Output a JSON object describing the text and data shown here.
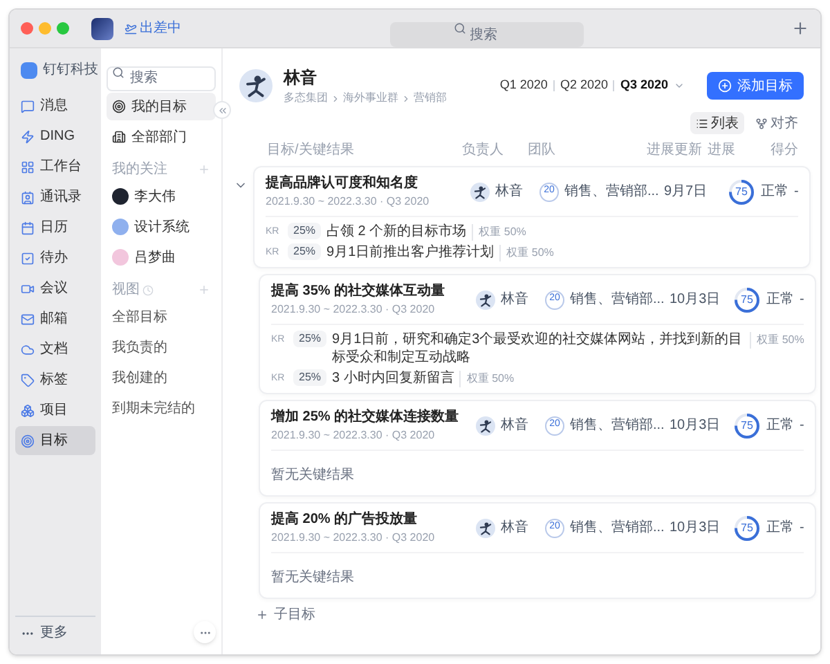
{
  "titlebar": {
    "status": "出差中",
    "search_placeholder": "搜索"
  },
  "org": {
    "name": "钉钉科技"
  },
  "nav": [
    {
      "label": "消息",
      "selected": false
    },
    {
      "label": "DING",
      "selected": false
    },
    {
      "label": "工作台",
      "selected": false
    },
    {
      "label": "通讯录",
      "selected": false
    },
    {
      "label": "日历",
      "selected": false
    },
    {
      "label": "待办",
      "selected": false
    },
    {
      "label": "会议",
      "selected": false
    },
    {
      "label": "邮箱",
      "selected": false
    },
    {
      "label": "文档",
      "selected": false
    },
    {
      "label": "标签",
      "selected": false
    },
    {
      "label": "项目",
      "selected": false
    },
    {
      "label": "目标",
      "selected": true
    }
  ],
  "more": "更多",
  "panel": {
    "search_placeholder": "搜索",
    "items": [
      {
        "label": "我的目标",
        "selected": true
      },
      {
        "label": "全部部门",
        "selected": false
      }
    ],
    "following_title": "我的关注",
    "following": [
      {
        "name": "李大伟",
        "color": "#1f2430"
      },
      {
        "name": "设计系统",
        "color": "#8fb0ee"
      },
      {
        "name": "吕梦曲",
        "color": "#f2c6dd"
      }
    ],
    "views_title": "视图",
    "views": [
      {
        "label": "全部目标",
        "selected": false
      },
      {
        "label": "我负责的",
        "selected": false
      },
      {
        "label": "我创建的",
        "selected": false
      },
      {
        "label": "到期未完结的",
        "selected": false
      }
    ]
  },
  "header": {
    "name": "林音",
    "path": [
      "多态集团",
      "海外事业群",
      "营销部"
    ],
    "quarters": [
      {
        "label": "Q1 2020",
        "selected": false
      },
      {
        "label": "Q2 2020",
        "selected": false
      },
      {
        "label": "Q3 2020",
        "selected": true
      }
    ],
    "add_button": "添加目标",
    "views": [
      {
        "label": "列表",
        "selected": true
      },
      {
        "label": "对齐",
        "selected": false
      }
    ]
  },
  "columns": [
    "目标/关键结果",
    "负责人",
    "团队",
    "进展更新",
    "进展",
    "得分"
  ],
  "goals": [
    {
      "title": "提高品牌认可度和知名度",
      "dates": "2021.9.30 ~ 2022.3.30 · Q3 2020",
      "owner": "林音",
      "team_count": "20",
      "team": "销售、营销部...",
      "updated": "9月7日",
      "progress": "75",
      "status": "正常",
      "score": "-",
      "expanded": true,
      "krs": [
        {
          "label": "KR",
          "percent": "25%",
          "text": "占领 2 个新的目标市场",
          "weight": "权重 50%"
        },
        {
          "label": "KR",
          "percent": "25%",
          "text": "9月1日前推出客户推荐计划",
          "weight": "权重 50%"
        }
      ],
      "children": [
        {
          "title": "提高 35% 的社交媒体互动量",
          "dates": "2021.9.30 ~ 2022.3.30 · Q3 2020",
          "owner": "林音",
          "team_count": "20",
          "team": "销售、营销部...",
          "updated": "10月3日",
          "progress": "75",
          "status": "正常",
          "score": "-",
          "krs": [
            {
              "label": "KR",
              "percent": "25%",
              "text": "9月1日前，研究和确定3个最受欢迎的社交媒体网站，并找到新的目标受众和制定互动战略",
              "weight": "权重 50%"
            },
            {
              "label": "KR",
              "percent": "25%",
              "text": "3 小时内回复新留言",
              "weight": "权重 50%"
            }
          ]
        },
        {
          "title": "增加 25% 的社交媒体连接数量",
          "dates": "2021.9.30 ~ 2022.3.30 · Q3 2020",
          "owner": "林音",
          "team_count": "20",
          "team": "销售、营销部...",
          "updated": "10月3日",
          "progress": "75",
          "status": "正常",
          "score": "-",
          "empty_text": "暂无关键结果"
        },
        {
          "title": "提高 20% 的广告投放量",
          "dates": "2021.9.30 ~ 2022.3.30 · Q3 2020",
          "owner": "林音",
          "team_count": "20",
          "team": "销售、营销部...",
          "updated": "10月3日",
          "progress": "75",
          "status": "正常",
          "score": "-",
          "empty_text": "暂无关键结果"
        }
      ],
      "add_child": "子目标"
    }
  ]
}
